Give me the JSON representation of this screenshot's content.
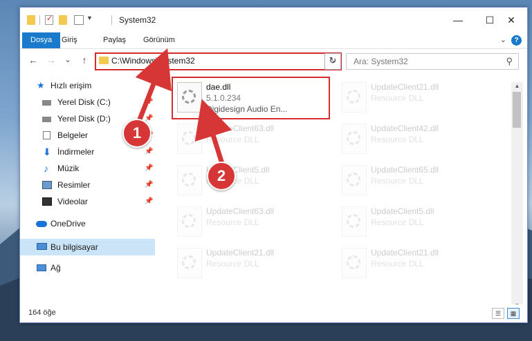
{
  "window": {
    "title": "System32",
    "controls": {
      "minimize": "—",
      "maximize": "☐",
      "close": "✕"
    }
  },
  "ribbon": {
    "tabs": [
      "Dosya",
      "Giriş",
      "Paylaş",
      "Görünüm"
    ],
    "expand_icon": "chevron-down-icon",
    "help_label": "?"
  },
  "nav": {
    "back": "←",
    "forward": "→",
    "recent": "⌄",
    "up": "↑",
    "address": "C:\\Windows\\System32",
    "address_dropdown": "⌄",
    "refresh": "↻",
    "search_placeholder": "Ara: System32",
    "search_icon": "⚲"
  },
  "sidebar": {
    "items": [
      {
        "label": "Hızlı erişim",
        "icon": "star-icon",
        "color": "#1a73d9"
      },
      {
        "label": "Yerel Disk (C:)",
        "icon": "drive-icon",
        "pinned": true
      },
      {
        "label": "Yerel Disk (D:)",
        "icon": "drive-icon",
        "pinned": true
      },
      {
        "label": "Belgeler",
        "icon": "documents-icon",
        "pinned": true
      },
      {
        "label": "İndirmeler",
        "icon": "download-icon",
        "pinned": true
      },
      {
        "label": "Müzik",
        "icon": "music-icon",
        "pinned": true
      },
      {
        "label": "Resimler",
        "icon": "pictures-icon",
        "pinned": true
      },
      {
        "label": "Videolar",
        "icon": "videos-icon",
        "pinned": true
      },
      {
        "label": "OneDrive",
        "icon": "cloud-icon"
      },
      {
        "label": "Bu bilgisayar",
        "icon": "computer-icon",
        "selected": true
      },
      {
        "label": "Ağ",
        "icon": "network-icon"
      }
    ]
  },
  "files": [
    {
      "name": "dae.dll",
      "line2": "5.1.0.234",
      "line3": "Digidesign Audio En...",
      "highlighted": true
    },
    {
      "name": "UpdateClient21.dll",
      "line2": "Resource DLL"
    },
    {
      "name": "UpdateClient63.dll",
      "line2": "Resource DLL"
    },
    {
      "name": "UpdateClient42.dll",
      "line2": "Resource DLL"
    },
    {
      "name": "UpdateClient5.dll",
      "line2": "Resource DLL"
    },
    {
      "name": "UpdateClient65.dll",
      "line2": "Resource DLL"
    },
    {
      "name": "UpdateClient63.dll",
      "line2": "Resource DLL"
    },
    {
      "name": "UpdateClient5.dll",
      "line2": "Resource DLL"
    },
    {
      "name": "UpdateClient21.dll",
      "line2": "Resource DLL"
    },
    {
      "name": "UpdateClient21.dll",
      "line2": "Resource DLL"
    }
  ],
  "status": {
    "count": "164 öğe",
    "details_view": "☰",
    "tiles_view": "▦"
  },
  "annotations": {
    "badge1": "1",
    "badge2": "2",
    "color": "#d63636"
  },
  "pin_glyph": "📌"
}
